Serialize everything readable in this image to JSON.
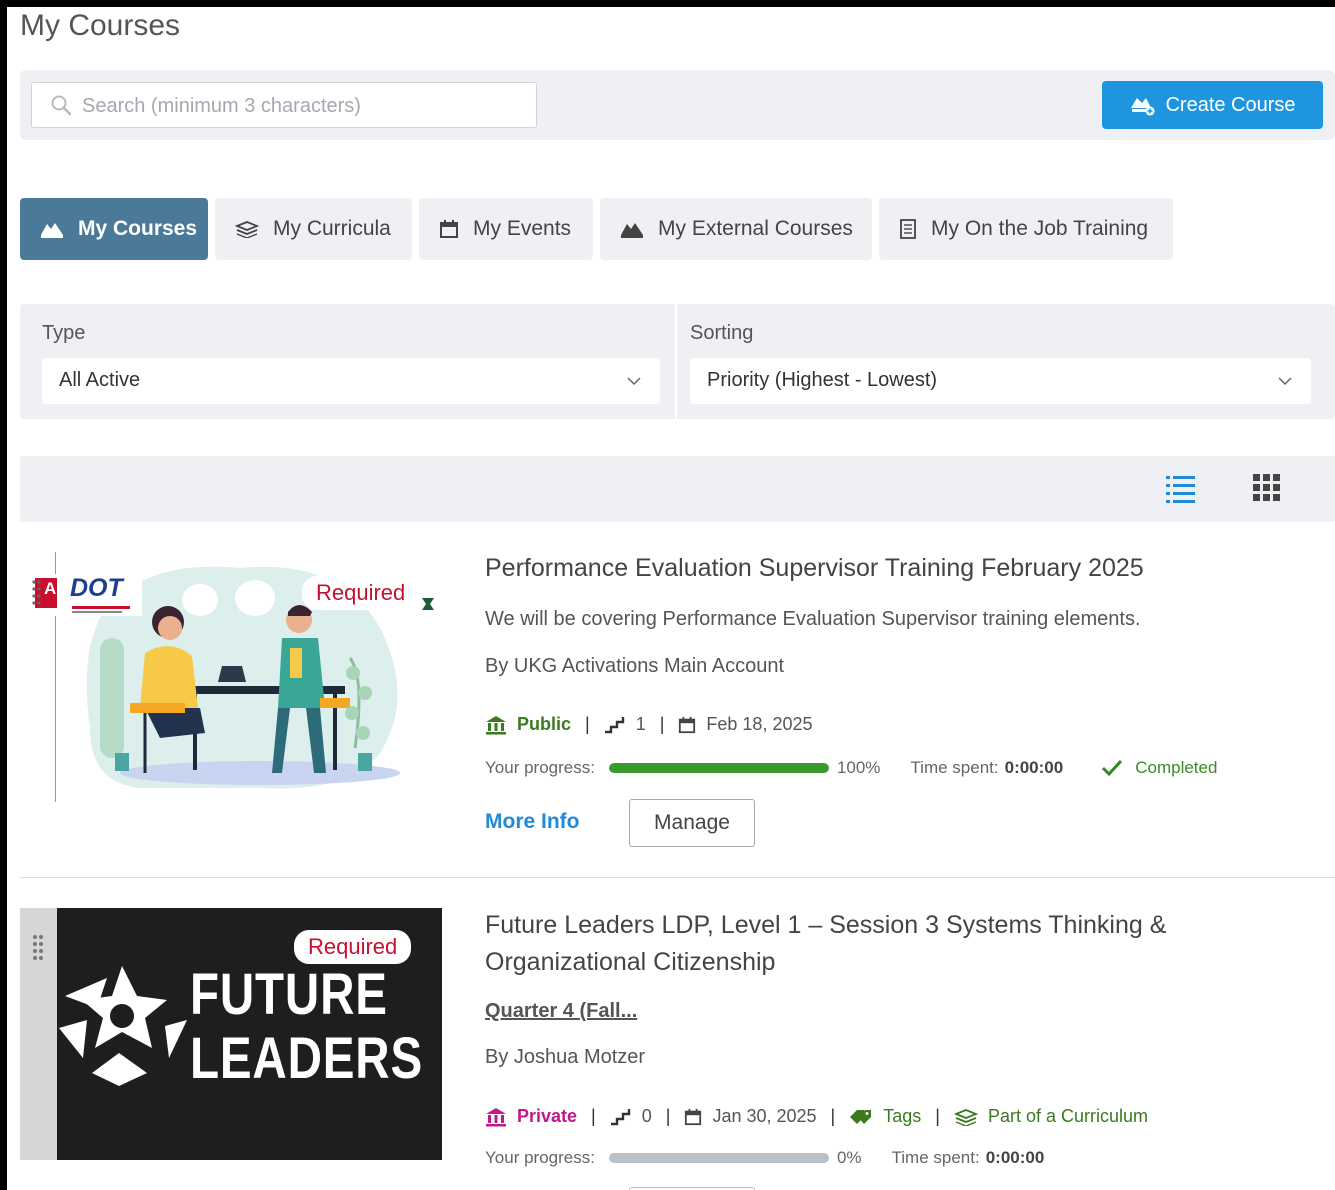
{
  "header": {
    "title": "My Courses",
    "search_placeholder": "Search (minimum 3 characters)",
    "create_label": "Create Course"
  },
  "tabs": [
    {
      "label": "My Courses",
      "icon": "courses-icon",
      "active": true
    },
    {
      "label": "My Curricula",
      "icon": "curricula-icon",
      "active": false
    },
    {
      "label": "My Events",
      "icon": "calendar-icon",
      "active": false
    },
    {
      "label": "My External Courses",
      "icon": "courses-icon",
      "active": false
    },
    {
      "label": "My On the Job Training",
      "icon": "document-icon",
      "active": false
    }
  ],
  "filters": {
    "type_label": "Type",
    "type_value": "All Active",
    "sort_label": "Sorting",
    "sort_value": "Priority (Highest - Lowest)"
  },
  "view_modes": [
    "list-view-icon",
    "grid-view-icon"
  ],
  "courses": [
    {
      "title": "Performance Evaluation Supervisor Training February 2025",
      "description": "We will be covering Performance Evaluation Supervisor training elements.",
      "by": "By UKG Activations Main Account",
      "badge": "Required",
      "logo_text": "DOT",
      "logo_prefix": "AR",
      "visibility": "Public",
      "steps": "1",
      "date": "Feb 18, 2025",
      "progress_label": "Your progress:",
      "progress": 1.0,
      "progress_text": "100%",
      "time_label": "Time spent:",
      "time_value": "0:00:00",
      "status": "Completed",
      "more_info": "More Info",
      "manage": "Manage"
    },
    {
      "title": "Future Leaders LDP, Level 1 – Session 3 Systems Thinking & Organizational Citizenship",
      "link": "Quarter 4 (Fall...",
      "by": "By Joshua Motzer",
      "badge": "Required",
      "banner_line1": "FUTURE",
      "banner_line2": "LEADERS",
      "visibility": "Private",
      "steps": "0",
      "date": "Jan 30, 2025",
      "tags": "Tags",
      "curriculum": "Part of a Curriculum",
      "progress_label": "Your progress:",
      "progress": 0.0,
      "progress_text": "0%",
      "time_label": "Time spent:",
      "time_value": "0:00:00"
    }
  ],
  "colors": {
    "accent": "#1f95e0",
    "tab_active": "#4a7a97",
    "public": "#3b7a1f",
    "private": "#c2188b",
    "required": "#c8102e",
    "progress": "#3b9a2d"
  }
}
